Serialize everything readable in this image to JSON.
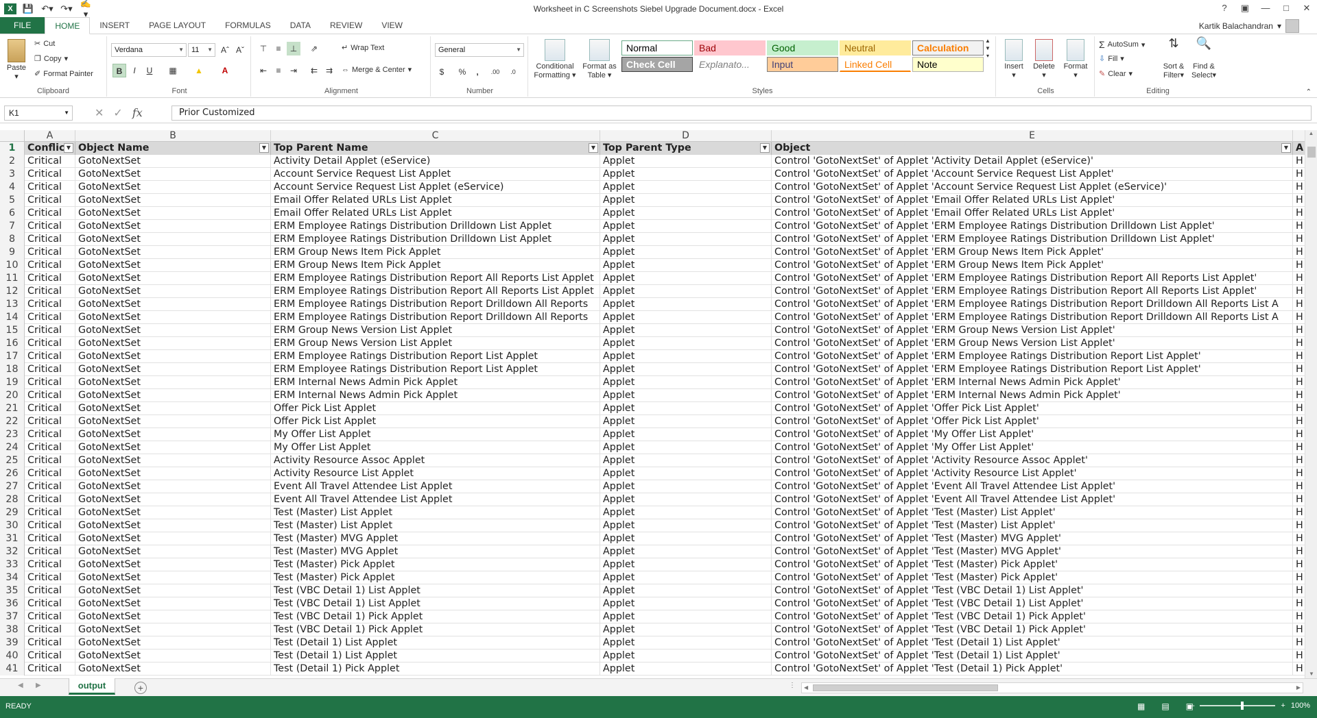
{
  "window": {
    "title": "Worksheet in C  Screenshots Siebel Upgrade Document.docx - Excel",
    "controls": [
      "?",
      "▣",
      "—",
      "□",
      "✕"
    ]
  },
  "quick_access": {
    "save": "save-icon",
    "undo": "undo-icon",
    "redo": "redo-icon",
    "touch": "touch-mode-icon"
  },
  "ribbon_tabs": [
    "FILE",
    "HOME",
    "INSERT",
    "PAGE LAYOUT",
    "FORMULAS",
    "DATA",
    "REVIEW",
    "VIEW"
  ],
  "active_tab": "HOME",
  "user": "Kartik Balachandran",
  "clipboard": {
    "paste": "Paste",
    "cut": "Cut",
    "copy": "Copy",
    "format_painter": "Format Painter",
    "label": "Clipboard"
  },
  "font": {
    "name": "Verdana",
    "size": "11",
    "bold": "B",
    "italic": "I",
    "underline": "U",
    "label": "Font"
  },
  "alignment": {
    "wrap_text": "Wrap Text",
    "merge_center": "Merge & Center",
    "label": "Alignment"
  },
  "number": {
    "format": "General",
    "currency": "$",
    "percent": "%",
    "comma": ",",
    "inc_decimal": ".00",
    "dec_decimal": ".0",
    "label": "Number"
  },
  "styles_group": {
    "conditional": "Conditional",
    "conditional2": "Formatting",
    "format_as": "Format as",
    "format_as2": "Table",
    "label": "Styles",
    "cells": [
      {
        "name": "Normal",
        "bg": "#ffffff",
        "color": "#000000",
        "border": "#6aaa88"
      },
      {
        "name": "Bad",
        "bg": "#ffc7ce",
        "color": "#9c0006",
        "border": "#ffc7ce"
      },
      {
        "name": "Good",
        "bg": "#c6efce",
        "color": "#006100",
        "border": "#c6efce"
      },
      {
        "name": "Neutral",
        "bg": "#ffeb9c",
        "color": "#9c6500",
        "border": "#ffeb9c"
      },
      {
        "name": "Calculation",
        "bg": "#f2f2f2",
        "color": "#fa7d00",
        "border": "#7f7f7f"
      },
      {
        "name": "Check Cell",
        "bg": "#a5a5a5",
        "color": "#ffffff",
        "border": "#3f3f3f"
      },
      {
        "name": "Explanato...",
        "bg": "#ffffff",
        "color": "#7f7f7f",
        "border": "#ffffff"
      },
      {
        "name": "Input",
        "bg": "#ffcc99",
        "color": "#3f3f76",
        "border": "#7f7f7f"
      },
      {
        "name": "Linked Cell",
        "bg": "#ffffff",
        "color": "#fa7d00",
        "border": "#ffffff"
      },
      {
        "name": "Note",
        "bg": "#ffffcc",
        "color": "#000000",
        "border": "#b2b2b2"
      }
    ]
  },
  "cells_group": {
    "insert": "Insert",
    "delete": "Delete",
    "format": "Format",
    "label": "Cells"
  },
  "editing": {
    "autosum": "AutoSum",
    "fill": "Fill",
    "clear": "Clear",
    "sort": "Sort &",
    "sort2": "Filter",
    "find": "Find &",
    "find2": "Select",
    "label": "Editing"
  },
  "formula_bar": {
    "name_box": "K1",
    "value": "Prior Customized",
    "fx": "fx"
  },
  "columns": [
    {
      "letter": "A",
      "header": "Conflict",
      "width": 74
    },
    {
      "letter": "B",
      "header": "Object Name",
      "width": 285
    },
    {
      "letter": "C",
      "header": "Top Parent Name",
      "width": 480
    },
    {
      "letter": "D",
      "header": "Top Parent Type",
      "width": 250
    },
    {
      "letter": "E",
      "header": "Object",
      "width": 760
    },
    {
      "letter": "A",
      "header": "A",
      "width": 53
    }
  ],
  "rows": [
    {
      "n": 2,
      "a": "Critical",
      "b": "GotoNextSet",
      "c": "Activity Detail Applet (eService)",
      "d": "Applet",
      "e": "Control 'GotoNextSet' of Applet 'Activity Detail Applet (eService)'",
      "f": "H"
    },
    {
      "n": 3,
      "a": "Critical",
      "b": "GotoNextSet",
      "c": "Account Service Request List Applet",
      "d": "Applet",
      "e": "Control 'GotoNextSet' of Applet 'Account Service Request List Applet'",
      "f": "H"
    },
    {
      "n": 4,
      "a": "Critical",
      "b": "GotoNextSet",
      "c": "Account Service Request List Applet (eService)",
      "d": "Applet",
      "e": "Control 'GotoNextSet' of Applet 'Account Service Request List Applet (eService)'",
      "f": "H"
    },
    {
      "n": 5,
      "a": "Critical",
      "b": "GotoNextSet",
      "c": "Email Offer Related URLs List Applet",
      "d": "Applet",
      "e": "Control 'GotoNextSet' of Applet 'Email Offer Related URLs List Applet'",
      "f": "H"
    },
    {
      "n": 6,
      "a": "Critical",
      "b": "GotoNextSet",
      "c": "Email Offer Related URLs List Applet",
      "d": "Applet",
      "e": "Control 'GotoNextSet' of Applet 'Email Offer Related URLs List Applet'",
      "f": "H"
    },
    {
      "n": 7,
      "a": "Critical",
      "b": "GotoNextSet",
      "c": "ERM Employee Ratings Distribution Drilldown List Applet",
      "d": "Applet",
      "e": "Control 'GotoNextSet' of Applet 'ERM Employee Ratings Distribution Drilldown List Applet'",
      "f": "H"
    },
    {
      "n": 8,
      "a": "Critical",
      "b": "GotoNextSet",
      "c": "ERM Employee Ratings Distribution Drilldown List Applet",
      "d": "Applet",
      "e": "Control 'GotoNextSet' of Applet 'ERM Employee Ratings Distribution Drilldown List Applet'",
      "f": "H"
    },
    {
      "n": 9,
      "a": "Critical",
      "b": "GotoNextSet",
      "c": "ERM Group News Item Pick Applet",
      "d": "Applet",
      "e": "Control 'GotoNextSet' of Applet 'ERM Group News Item Pick Applet'",
      "f": "H"
    },
    {
      "n": 10,
      "a": "Critical",
      "b": "GotoNextSet",
      "c": "ERM Group News Item Pick Applet",
      "d": "Applet",
      "e": "Control 'GotoNextSet' of Applet 'ERM Group News Item Pick Applet'",
      "f": "H"
    },
    {
      "n": 11,
      "a": "Critical",
      "b": "GotoNextSet",
      "c": "ERM Employee Ratings Distribution Report All Reports List Applet",
      "d": "Applet",
      "e": "Control 'GotoNextSet' of Applet 'ERM Employee Ratings Distribution Report All Reports List Applet'",
      "f": "H"
    },
    {
      "n": 12,
      "a": "Critical",
      "b": "GotoNextSet",
      "c": "ERM Employee Ratings Distribution Report All Reports List Applet",
      "d": "Applet",
      "e": "Control 'GotoNextSet' of Applet 'ERM Employee Ratings Distribution Report All Reports List Applet'",
      "f": "H"
    },
    {
      "n": 13,
      "a": "Critical",
      "b": "GotoNextSet",
      "c": "ERM Employee Ratings Distribution Report Drilldown All Reports",
      "d": "Applet",
      "e": "Control 'GotoNextSet' of Applet 'ERM Employee Ratings Distribution Report Drilldown All Reports List A",
      "f": "H"
    },
    {
      "n": 14,
      "a": "Critical",
      "b": "GotoNextSet",
      "c": "ERM Employee Ratings Distribution Report Drilldown All Reports",
      "d": "Applet",
      "e": "Control 'GotoNextSet' of Applet 'ERM Employee Ratings Distribution Report Drilldown All Reports List A",
      "f": "H"
    },
    {
      "n": 15,
      "a": "Critical",
      "b": "GotoNextSet",
      "c": "ERM Group News Version List Applet",
      "d": "Applet",
      "e": "Control 'GotoNextSet' of Applet 'ERM Group News Version List Applet'",
      "f": "H"
    },
    {
      "n": 16,
      "a": "Critical",
      "b": "GotoNextSet",
      "c": "ERM Group News Version List Applet",
      "d": "Applet",
      "e": "Control 'GotoNextSet' of Applet 'ERM Group News Version List Applet'",
      "f": "H"
    },
    {
      "n": 17,
      "a": "Critical",
      "b": "GotoNextSet",
      "c": "ERM Employee Ratings Distribution Report List Applet",
      "d": "Applet",
      "e": "Control 'GotoNextSet' of Applet 'ERM Employee Ratings Distribution Report List Applet'",
      "f": "H"
    },
    {
      "n": 18,
      "a": "Critical",
      "b": "GotoNextSet",
      "c": "ERM Employee Ratings Distribution Report List Applet",
      "d": "Applet",
      "e": "Control 'GotoNextSet' of Applet 'ERM Employee Ratings Distribution Report List Applet'",
      "f": "H"
    },
    {
      "n": 19,
      "a": "Critical",
      "b": "GotoNextSet",
      "c": "ERM Internal News Admin Pick Applet",
      "d": "Applet",
      "e": "Control 'GotoNextSet' of Applet 'ERM Internal News Admin Pick Applet'",
      "f": "H"
    },
    {
      "n": 20,
      "a": "Critical",
      "b": "GotoNextSet",
      "c": "ERM Internal News Admin Pick Applet",
      "d": "Applet",
      "e": "Control 'GotoNextSet' of Applet 'ERM Internal News Admin Pick Applet'",
      "f": "H"
    },
    {
      "n": 21,
      "a": "Critical",
      "b": "GotoNextSet",
      "c": "Offer Pick List Applet",
      "d": "Applet",
      "e": "Control 'GotoNextSet' of Applet 'Offer Pick List Applet'",
      "f": "H"
    },
    {
      "n": 22,
      "a": "Critical",
      "b": "GotoNextSet",
      "c": "Offer Pick List Applet",
      "d": "Applet",
      "e": "Control 'GotoNextSet' of Applet 'Offer Pick List Applet'",
      "f": "H"
    },
    {
      "n": 23,
      "a": "Critical",
      "b": "GotoNextSet",
      "c": "My Offer List Applet",
      "d": "Applet",
      "e": "Control 'GotoNextSet' of Applet 'My Offer List Applet'",
      "f": "H"
    },
    {
      "n": 24,
      "a": "Critical",
      "b": "GotoNextSet",
      "c": "My Offer List Applet",
      "d": "Applet",
      "e": "Control 'GotoNextSet' of Applet 'My Offer List Applet'",
      "f": "H"
    },
    {
      "n": 25,
      "a": "Critical",
      "b": "GotoNextSet",
      "c": "Activity Resource Assoc Applet",
      "d": "Applet",
      "e": "Control 'GotoNextSet' of Applet 'Activity Resource Assoc Applet'",
      "f": "H"
    },
    {
      "n": 26,
      "a": "Critical",
      "b": "GotoNextSet",
      "c": "Activity Resource List Applet",
      "d": "Applet",
      "e": "Control 'GotoNextSet' of Applet 'Activity Resource List Applet'",
      "f": "H"
    },
    {
      "n": 27,
      "a": "Critical",
      "b": "GotoNextSet",
      "c": "Event All Travel Attendee List Applet",
      "d": "Applet",
      "e": "Control 'GotoNextSet' of Applet 'Event All Travel Attendee List Applet'",
      "f": "H"
    },
    {
      "n": 28,
      "a": "Critical",
      "b": "GotoNextSet",
      "c": "Event All Travel Attendee List Applet",
      "d": "Applet",
      "e": "Control 'GotoNextSet' of Applet 'Event All Travel Attendee List Applet'",
      "f": "H"
    },
    {
      "n": 29,
      "a": "Critical",
      "b": "GotoNextSet",
      "c": "Test (Master) List Applet",
      "d": "Applet",
      "e": "Control 'GotoNextSet' of Applet 'Test (Master) List Applet'",
      "f": "H"
    },
    {
      "n": 30,
      "a": "Critical",
      "b": "GotoNextSet",
      "c": "Test (Master) List Applet",
      "d": "Applet",
      "e": "Control 'GotoNextSet' of Applet 'Test (Master) List Applet'",
      "f": "H"
    },
    {
      "n": 31,
      "a": "Critical",
      "b": "GotoNextSet",
      "c": "Test (Master) MVG Applet",
      "d": "Applet",
      "e": "Control 'GotoNextSet' of Applet 'Test (Master) MVG Applet'",
      "f": "H"
    },
    {
      "n": 32,
      "a": "Critical",
      "b": "GotoNextSet",
      "c": "Test (Master) MVG Applet",
      "d": "Applet",
      "e": "Control 'GotoNextSet' of Applet 'Test (Master) MVG Applet'",
      "f": "H"
    },
    {
      "n": 33,
      "a": "Critical",
      "b": "GotoNextSet",
      "c": "Test (Master) Pick Applet",
      "d": "Applet",
      "e": "Control 'GotoNextSet' of Applet 'Test (Master) Pick Applet'",
      "f": "H"
    },
    {
      "n": 34,
      "a": "Critical",
      "b": "GotoNextSet",
      "c": "Test (Master) Pick Applet",
      "d": "Applet",
      "e": "Control 'GotoNextSet' of Applet 'Test (Master) Pick Applet'",
      "f": "H"
    },
    {
      "n": 35,
      "a": "Critical",
      "b": "GotoNextSet",
      "c": "Test (VBC Detail 1) List Applet",
      "d": "Applet",
      "e": "Control 'GotoNextSet' of Applet 'Test (VBC Detail 1) List Applet'",
      "f": "H"
    },
    {
      "n": 36,
      "a": "Critical",
      "b": "GotoNextSet",
      "c": "Test (VBC Detail 1) List Applet",
      "d": "Applet",
      "e": "Control 'GotoNextSet' of Applet 'Test (VBC Detail 1) List Applet'",
      "f": "H"
    },
    {
      "n": 37,
      "a": "Critical",
      "b": "GotoNextSet",
      "c": "Test (VBC Detail 1) Pick Applet",
      "d": "Applet",
      "e": "Control 'GotoNextSet' of Applet 'Test (VBC Detail 1) Pick Applet'",
      "f": "H"
    },
    {
      "n": 38,
      "a": "Critical",
      "b": "GotoNextSet",
      "c": "Test (VBC Detail 1) Pick Applet",
      "d": "Applet",
      "e": "Control 'GotoNextSet' of Applet 'Test (VBC Detail 1) Pick Applet'",
      "f": "H"
    },
    {
      "n": 39,
      "a": "Critical",
      "b": "GotoNextSet",
      "c": "Test (Detail 1) List Applet",
      "d": "Applet",
      "e": "Control 'GotoNextSet' of Applet 'Test (Detail 1) List Applet'",
      "f": "H"
    },
    {
      "n": 40,
      "a": "Critical",
      "b": "GotoNextSet",
      "c": "Test (Detail 1) List Applet",
      "d": "Applet",
      "e": "Control 'GotoNextSet' of Applet 'Test (Detail 1) List Applet'",
      "f": "H"
    },
    {
      "n": 41,
      "a": "Critical",
      "b": "GotoNextSet",
      "c": "Test (Detail 1) Pick Applet",
      "d": "Applet",
      "e": "Control 'GotoNextSet' of Applet 'Test (Detail 1) Pick Applet'",
      "f": "H"
    }
  ],
  "sheet_tabs": [
    "output"
  ],
  "status": {
    "mode": "READY",
    "zoom": "100%"
  },
  "colors": {
    "accent": "#217346",
    "status_bar": "#217346"
  }
}
